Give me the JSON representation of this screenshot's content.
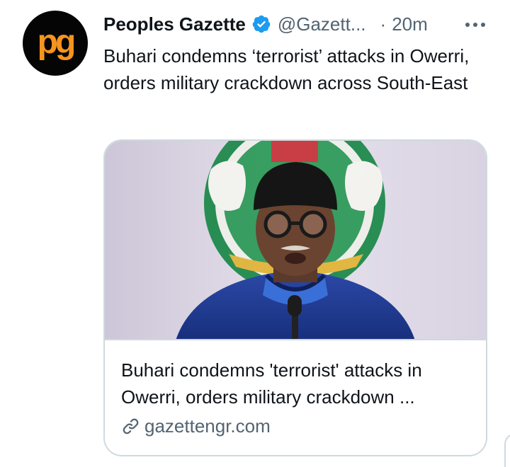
{
  "account": {
    "display_name": "Peoples Gazette",
    "handle": "@Gazett...",
    "separator": "·",
    "timestamp": "20m",
    "avatar_text": "pg",
    "verified": true
  },
  "tweet": {
    "text": "Buhari condemns ‘terrorist’ attacks in Owerri, orders military crackdown across South-East"
  },
  "card": {
    "title": "Buhari condemns 'terrorist' attacks in Owerri, orders military crackdown ...",
    "domain": "gazettengr.com"
  },
  "icons": {
    "verified": "verified-badge-icon",
    "more": "more-horizontal-icon",
    "link": "link-icon"
  },
  "colors": {
    "verified_blue": "#1d9bf0",
    "avatar_bg": "#050505",
    "avatar_letters": "#f7941d",
    "secondary_text": "#536471",
    "border": "#cfd9de"
  }
}
